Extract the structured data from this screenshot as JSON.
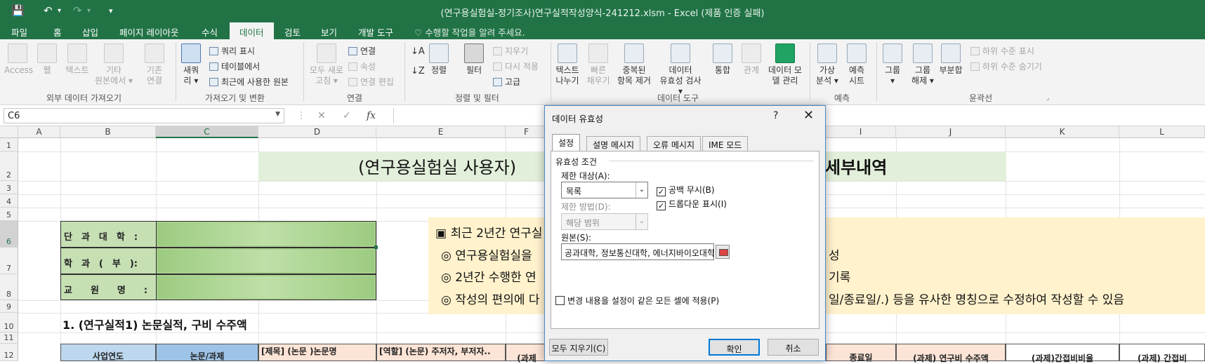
{
  "window": {
    "title": "(연구용실험실-정기조사)연구실적작성양식-241212.xlsm - Excel (제품 인증 실패)",
    "qat": {
      "save": "💾",
      "undo": "↶",
      "undo_drop": "▾",
      "redo": "↷",
      "redo_drop": "▾",
      "customize": "▾"
    }
  },
  "tabs": [
    {
      "label": "파일"
    },
    {
      "label": "홈"
    },
    {
      "label": "삽입"
    },
    {
      "label": "페이지 레이아웃"
    },
    {
      "label": "수식"
    },
    {
      "label": "데이터"
    },
    {
      "label": "검토"
    },
    {
      "label": "보기"
    },
    {
      "label": "개발 도구"
    }
  ],
  "tell_me": "수행할 작업을 알려 주세요.",
  "ribbon": {
    "external": {
      "access": "Access",
      "web": "웹",
      "text": "텍스트",
      "other1": "기타",
      "other2": "원본에서 ▾",
      "existing1": "기존",
      "existing2": "연결",
      "group": "외부 데이터 가져오기"
    },
    "transform": {
      "new_query1": "새쿼",
      "new_query2": "리 ▾",
      "show_queries": "쿼리 표시",
      "from_table": "테이블에서",
      "recent": "최근에 사용한 원본",
      "group": "가져오기 및 변환"
    },
    "connections": {
      "refresh1": "모두 새로",
      "refresh2": "고침 ▾",
      "connections": "연결",
      "properties": "속성",
      "edit_links": "연결 편집",
      "group": "연결"
    },
    "sort_filter": {
      "sort": "정렬",
      "filter": "필터",
      "clear": "지우기",
      "reapply": "다시 적용",
      "advanced": "고급",
      "group": "정렬 및 필터"
    },
    "data_tools": {
      "text_to_cols1": "텍스트",
      "text_to_cols2": "나누기",
      "flash_fill1": "빠른",
      "flash_fill2": "채우기",
      "remove_dup1": "중복된",
      "remove_dup2": "항목 제거",
      "validation1": "데이터",
      "validation2": "유효성 검사 ▾",
      "consolidate": "통합",
      "relations": "관계",
      "model1": "데이터 모",
      "model2": "델 관리",
      "group": "데이터 도구"
    },
    "forecast": {
      "whatif1": "가상",
      "whatif2": "분석 ▾",
      "sheet1": "예측",
      "sheet2": "시트",
      "group": "예측"
    },
    "outline": {
      "group_btn1": "그룹",
      "group_btn2": "▾",
      "ungroup1": "그룹",
      "ungroup2": "해제 ▾",
      "subtotal": "부분합",
      "show_detail": "하위 수준 표시",
      "hide_detail": "하위 수준 숨기기",
      "group": "윤곽선"
    }
  },
  "formula_bar": {
    "name_box": "C6",
    "cancel": "✕",
    "enter": "✓",
    "fx": "fx"
  },
  "columns": [
    "A",
    "B",
    "C",
    "D",
    "E",
    "F",
    "G",
    "H",
    "I",
    "J",
    "K",
    "L"
  ],
  "rows": [
    "1",
    "2",
    "3",
    "4",
    "5",
    "6",
    "7",
    "8",
    "9",
    "10",
    "11",
    "12"
  ],
  "sheet": {
    "banner_left": "(연구용실험실 사용자)",
    "banner_right": "세부내역",
    "info_labels": [
      "단　과　대　학　:",
      "학　과　(　부　):",
      "교　　원　　명　　:"
    ],
    "notes": [
      "▣ 최근 2년간 연구실",
      "◎ 연구용실험실을",
      "◎ 2년간 수행한 연",
      "◎  작성의 편의에 다"
    ],
    "notes_right": [
      "성",
      "기록",
      "일/종료일/.) 등을 유사한 명칭으로 수정하여 작성할 수 있음"
    ],
    "section_title": "1. (연구실적1) 논문실적,  구비 수주액",
    "table_headers": [
      "사업연도",
      "논문/과제",
      "[제목] (논문 )논문명",
      "[역할] (논문) 주저자, 부저자..",
      "(과제",
      "종료일",
      "(과제) 연구비 수주액",
      "(과제)간접비비율",
      "(과제) 간접비"
    ]
  },
  "dialog": {
    "title": "데이터 유효성",
    "help": "?",
    "close": "✕",
    "tabs": [
      "설정",
      "설명 메시지",
      "오류 메시지",
      "IME 모드"
    ],
    "criteria_label": "유효성 조건",
    "allow_label": "제한 대상(A):",
    "allow_value": "목록",
    "ignore_blank": "공백 무시(B)",
    "dropdown": "드롭다운 표시(I)",
    "check_mark": "✓",
    "data_label": "제한 방법(D):",
    "data_value": "해당 범위",
    "source_label": "원본(S):",
    "source_value": "공과대학, 정보통신대학, 에너지바이오대학",
    "apply_all": "변경 내용을 설정이 같은 모든 셀에 적용(P)",
    "clear_all": "모두 지우기(C)",
    "ok": "확인",
    "cancel": "취소",
    "arrow": "⌄"
  }
}
